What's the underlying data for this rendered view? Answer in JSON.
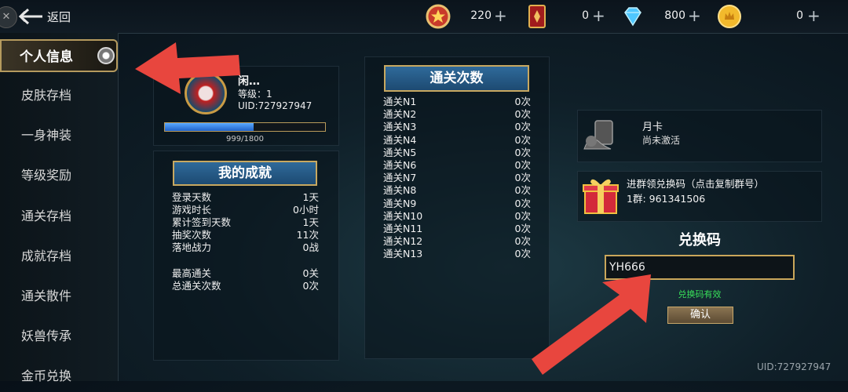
{
  "header": {
    "back_label": "返回",
    "currencies": [
      {
        "icon": "badge-star-icon",
        "value": "220"
      },
      {
        "icon": "card-icon",
        "value": "0"
      },
      {
        "icon": "diamond-icon",
        "value": "800"
      },
      {
        "icon": "gold-coin-icon",
        "value": "0"
      }
    ],
    "plus": "+"
  },
  "sidebar": {
    "items": [
      "个人信息",
      "皮肤存档",
      "一身神装",
      "等级奖励",
      "通关存档",
      "成就存档",
      "通关散件",
      "妖兽传承",
      "金币兑换"
    ],
    "active_index": 0
  },
  "profile": {
    "name": "闲…",
    "level": "等级：1",
    "uid": "UID:727927947",
    "xp_text": "999/1800",
    "xp_fraction": 0.555
  },
  "achievements": {
    "title": "我的成就",
    "rows": [
      {
        "label": "登录天数",
        "value": "1天"
      },
      {
        "label": "游戏时长",
        "value": "0小时"
      },
      {
        "label": "累计签到天数",
        "value": "1天"
      },
      {
        "label": "抽奖次数",
        "value": "11次"
      },
      {
        "label": "落地战力",
        "value": "0战"
      },
      {
        "label": "最高通关",
        "value": "0关"
      },
      {
        "label": "总通关次数",
        "value": "0次"
      }
    ]
  },
  "clears": {
    "title": "通关次数",
    "rows": [
      {
        "label": "通关N1",
        "value": "0次"
      },
      {
        "label": "通关N2",
        "value": "0次"
      },
      {
        "label": "通关N3",
        "value": "0次"
      },
      {
        "label": "通关N4",
        "value": "0次"
      },
      {
        "label": "通关N5",
        "value": "0次"
      },
      {
        "label": "通关N6",
        "value": "0次"
      },
      {
        "label": "通关N7",
        "value": "0次"
      },
      {
        "label": "通关N8",
        "value": "0次"
      },
      {
        "label": "通关N9",
        "value": "0次"
      },
      {
        "label": "通关N10",
        "value": "0次"
      },
      {
        "label": "通关N11",
        "value": "0次"
      },
      {
        "label": "通关N12",
        "value": "0次"
      },
      {
        "label": "通关N13",
        "value": "0次"
      }
    ]
  },
  "month_card": {
    "title": "月卡",
    "status": "尚未激活"
  },
  "group": {
    "title": "进群领兑换码（点击复制群号）",
    "number": "1群:  961341506"
  },
  "redeem": {
    "title": "兑换码",
    "value": "YH666",
    "status": "兑换码有效",
    "confirm": "确认"
  },
  "footer_uid": "UID:727927947",
  "colors": {
    "annotation_arrow": "#e8463e",
    "status_green": "#39e05a",
    "gold_border": "#c8a860"
  }
}
